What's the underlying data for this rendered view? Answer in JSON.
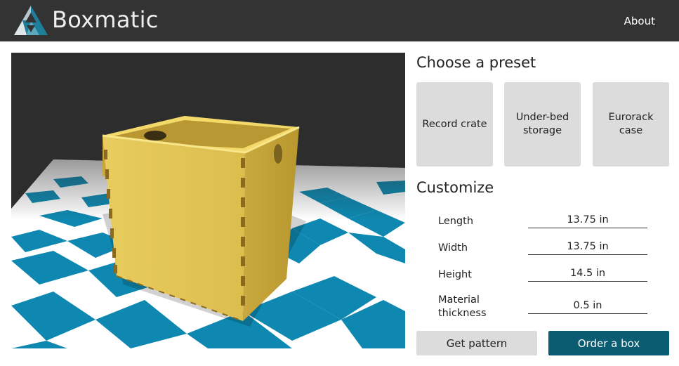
{
  "app": {
    "brand": "Boxmatic",
    "nav_about": "About"
  },
  "presets": {
    "heading": "Choose a preset",
    "items": [
      "Record crate",
      "Under-bed storage",
      "Eurorack case"
    ]
  },
  "customize": {
    "heading": "Customize",
    "fields": [
      {
        "label": "Length",
        "value": "13.75 in"
      },
      {
        "label": "Width",
        "value": "13.75 in"
      },
      {
        "label": "Height",
        "value": "14.5 in"
      },
      {
        "label": "Material thickness",
        "value": "0.5 in"
      }
    ]
  },
  "actions": {
    "get_pattern": "Get pattern",
    "order": "Order a box"
  },
  "colors": {
    "header_bg": "#333333",
    "accent": "#0a5c73",
    "floor_tile": "#0e88b0",
    "box_wood": "#e3c354",
    "preset_bg": "#dcdcdc"
  },
  "icons": {
    "logo": "boxmatic-logo-icon"
  }
}
